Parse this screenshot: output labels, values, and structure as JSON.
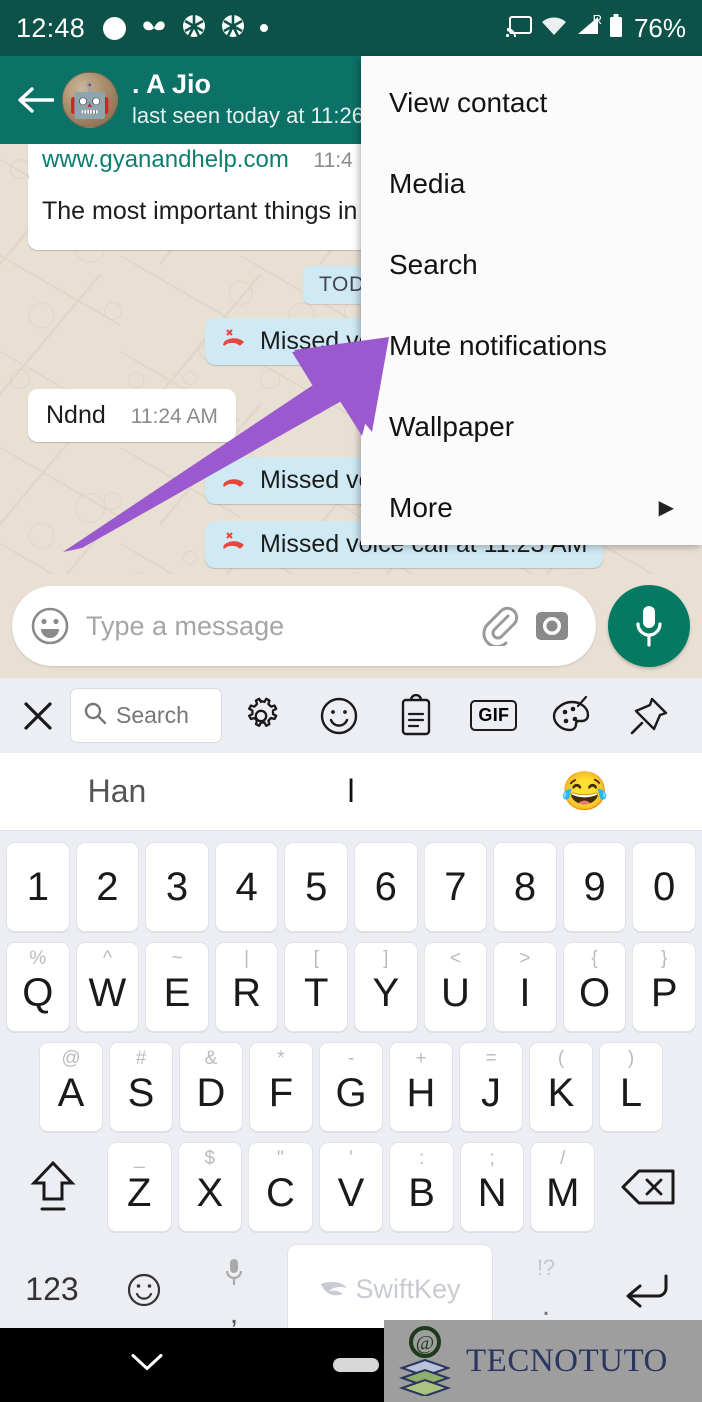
{
  "status_bar": {
    "time": "12:48",
    "battery_percent": "76%",
    "icons": [
      "circle-indicator-icon",
      "moustache-icon",
      "camera-aperture-icon",
      "camera-aperture-icon",
      "dot-icon"
    ],
    "right_icons": [
      "cast-icon",
      "wifi-icon",
      "cellular-signal-icon",
      "battery-icon"
    ],
    "roaming_label": "R",
    "background_color": "#0c5249"
  },
  "chat_header": {
    "back_label": "back-arrow",
    "contact_name": ". A Jio",
    "contact_status": "last seen today at 11:26",
    "avatar_glyph": "🤖",
    "background_color": "#0c7166"
  },
  "chat": {
    "date_divider": "TODAY",
    "messages": [
      {
        "type": "link-partial",
        "text": "www.gyanandhelp.com",
        "time": "11:4"
      },
      {
        "type": "incoming",
        "text": "The most important things in l"
      },
      {
        "type": "missed-call",
        "text": "Missed voi",
        "icon": "missed-voice-call-icon"
      },
      {
        "type": "incoming",
        "text": "Ndnd",
        "time": "11:24 AM"
      },
      {
        "type": "missed-call",
        "text": "Missed voice c",
        "icon": "missed-voice-call-icon"
      },
      {
        "type": "missed-call",
        "text": "Missed voice call at 11:23 AM",
        "icon": "missed-voice-call-icon"
      }
    ],
    "bubble_in_color": "#ffffff",
    "bubble_call_color": "#cfe9f5",
    "wallpaper_color": "#e9e0d4"
  },
  "overflow_menu": {
    "items": [
      {
        "label": "View contact",
        "has_submenu": false
      },
      {
        "label": "Media",
        "has_submenu": false
      },
      {
        "label": "Search",
        "has_submenu": false
      },
      {
        "label": "Mute notifications",
        "has_submenu": true
      },
      {
        "label": "Wallpaper",
        "has_submenu": false
      },
      {
        "label": "More",
        "has_submenu": true,
        "arrow": "▶"
      }
    ],
    "background_color": "#fbfbfb"
  },
  "annotation": {
    "arrow_color": "#9b59d0",
    "points_to": "Mute notifications"
  },
  "input_bar": {
    "placeholder": "Type a message",
    "emoji_icon": "emoji-smiley-icon",
    "attach_icon": "paperclip-icon",
    "camera_icon": "camera-icon",
    "mic_icon": "microphone-icon",
    "mic_button_color": "#057a63"
  },
  "keyboard_toolbar": {
    "close_icon": "close-icon",
    "search_label": "Search",
    "search_icon": "search-icon",
    "tools": [
      {
        "name": "settings-gear-icon"
      },
      {
        "name": "sticker-smiley-icon"
      },
      {
        "name": "clipboard-icon"
      },
      {
        "name": "gif-icon",
        "label": "GIF"
      },
      {
        "name": "theme-palette-icon"
      },
      {
        "name": "pin-icon"
      }
    ],
    "background_color": "#eceef3"
  },
  "suggestions": {
    "items": [
      "Han",
      "l",
      "😂"
    ]
  },
  "keyboard": {
    "brand": "SwiftKey",
    "rows": {
      "numbers": [
        "1",
        "2",
        "3",
        "4",
        "5",
        "6",
        "7",
        "8",
        "9",
        "0"
      ],
      "q_row": [
        {
          "key": "Q",
          "hint": "%"
        },
        {
          "key": "W",
          "hint": "^"
        },
        {
          "key": "E",
          "hint": "~"
        },
        {
          "key": "R",
          "hint": "|"
        },
        {
          "key": "T",
          "hint": "["
        },
        {
          "key": "Y",
          "hint": "]"
        },
        {
          "key": "U",
          "hint": "<"
        },
        {
          "key": "I",
          "hint": ">"
        },
        {
          "key": "O",
          "hint": "{"
        },
        {
          "key": "P",
          "hint": "}"
        }
      ],
      "a_row": [
        {
          "key": "A",
          "hint": "@"
        },
        {
          "key": "S",
          "hint": "#"
        },
        {
          "key": "D",
          "hint": "&"
        },
        {
          "key": "F",
          "hint": "*"
        },
        {
          "key": "G",
          "hint": "-"
        },
        {
          "key": "H",
          "hint": "+"
        },
        {
          "key": "J",
          "hint": "="
        },
        {
          "key": "K",
          "hint": "("
        },
        {
          "key": "L",
          "hint": ")"
        }
      ],
      "z_row": [
        {
          "key": "Z",
          "hint": "_"
        },
        {
          "key": "X",
          "hint": "$"
        },
        {
          "key": "C",
          "hint": "\""
        },
        {
          "key": "V",
          "hint": "'"
        },
        {
          "key": "B",
          "hint": ":"
        },
        {
          "key": "N",
          "hint": ";"
        },
        {
          "key": "M",
          "hint": "/"
        }
      ],
      "bottom": {
        "numeric_label": "123",
        "emoji_icon": "emoji-key-icon",
        "comma": ",",
        "mic_icon": "microphone-key-icon",
        "period": ".",
        "period_hint": "!?",
        "enter_icon": "enter-key-icon",
        "shift_icon": "shift-key-icon",
        "backspace_icon": "backspace-key-icon"
      }
    },
    "key_color": "#ffffff",
    "background_color": "#eceef3"
  },
  "nav_bar": {
    "down_icon": "chevron-down-icon",
    "home_pill": "home-pill-indicator",
    "background_color": "#000000"
  },
  "watermark": {
    "text": "TECNOTUTO",
    "logo": "books-at-logo"
  }
}
